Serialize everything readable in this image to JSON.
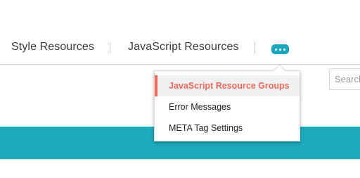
{
  "nav": {
    "tabs": [
      {
        "label": "Style Resources"
      },
      {
        "label": "JavaScript Resources"
      }
    ],
    "more_icon": "ellipsis-icon"
  },
  "search": {
    "placeholder": "Search"
  },
  "dropdown": {
    "items": [
      {
        "label": "JavaScript Resource Groups",
        "active": true
      },
      {
        "label": "Error Messages"
      },
      {
        "label": "META Tag Settings"
      }
    ]
  },
  "colors": {
    "accent_teal": "#1eabbd",
    "active_item": "#ee6a5c"
  }
}
